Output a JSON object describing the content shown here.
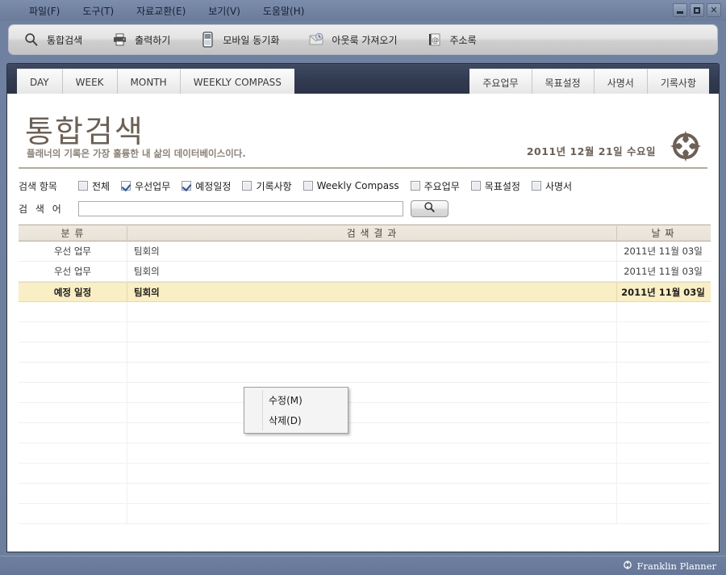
{
  "window": {
    "minimize_label": "Minimize",
    "maximize_label": "Maximize",
    "close_label": "Close"
  },
  "menubar": {
    "items": [
      {
        "label": "파일(F)"
      },
      {
        "label": "도구(T)"
      },
      {
        "label": "자료교환(E)"
      },
      {
        "label": "보기(V)"
      },
      {
        "label": "도움말(H)"
      }
    ]
  },
  "toolbar": {
    "items": [
      {
        "label": "통합검색",
        "icon": "search-icon"
      },
      {
        "label": "출력하기",
        "icon": "printer-icon"
      },
      {
        "label": "모바일 동기화",
        "icon": "mobile-phone-icon"
      },
      {
        "label": "아웃룩 가져오기",
        "icon": "outlook-import-icon"
      },
      {
        "label": "주소록",
        "icon": "address-book-icon"
      }
    ]
  },
  "tabs": {
    "left": [
      {
        "label": "DAY"
      },
      {
        "label": "WEEK"
      },
      {
        "label": "MONTH"
      },
      {
        "label": "WEEKLY COMPASS"
      }
    ],
    "right": [
      {
        "label": "주요업무"
      },
      {
        "label": "목표설정"
      },
      {
        "label": "사명서"
      },
      {
        "label": "기록사항"
      }
    ]
  },
  "hero": {
    "title": "통합검색",
    "subtitle": "플래너의 기록은 가장 훌륭한 내 삶의 데이터베이스이다.",
    "date": "2011년 12월 21일 수요일",
    "logo": "compass-logo-icon"
  },
  "filters": {
    "label": "검색 항목",
    "checkboxes": [
      {
        "label": "전체",
        "checked": false
      },
      {
        "label": "우선업무",
        "checked": true
      },
      {
        "label": "예정일정",
        "checked": true
      },
      {
        "label": "기록사항",
        "checked": false
      },
      {
        "label": "Weekly Compass",
        "checked": false
      },
      {
        "label": "주요업무",
        "checked": false
      },
      {
        "label": "목표설정",
        "checked": false
      },
      {
        "label": "사명서",
        "checked": false
      }
    ]
  },
  "search": {
    "label": "검 색 어",
    "value": "",
    "placeholder": "",
    "button_icon": "search-icon"
  },
  "results": {
    "columns": [
      "분 류",
      "검 색  결 과",
      "날 짜"
    ],
    "rows": [
      {
        "category": "우선 업무",
        "result": "팀회의",
        "date": "2011년 11월 03일",
        "selected": false
      },
      {
        "category": "우선 업무",
        "result": "팀회의",
        "date": "2011년 11월 03일",
        "selected": false
      },
      {
        "category": "예정 일정",
        "result": "팀회의",
        "date": "2011년 11월 03일",
        "selected": true
      }
    ],
    "empty_row_count": 10
  },
  "context_menu": {
    "items": [
      {
        "label": "수정(M)"
      },
      {
        "label": "삭제(D)"
      }
    ]
  },
  "statusbar": {
    "brand": "Franklin Planner",
    "brand_icon": "compass-logo-icon"
  }
}
